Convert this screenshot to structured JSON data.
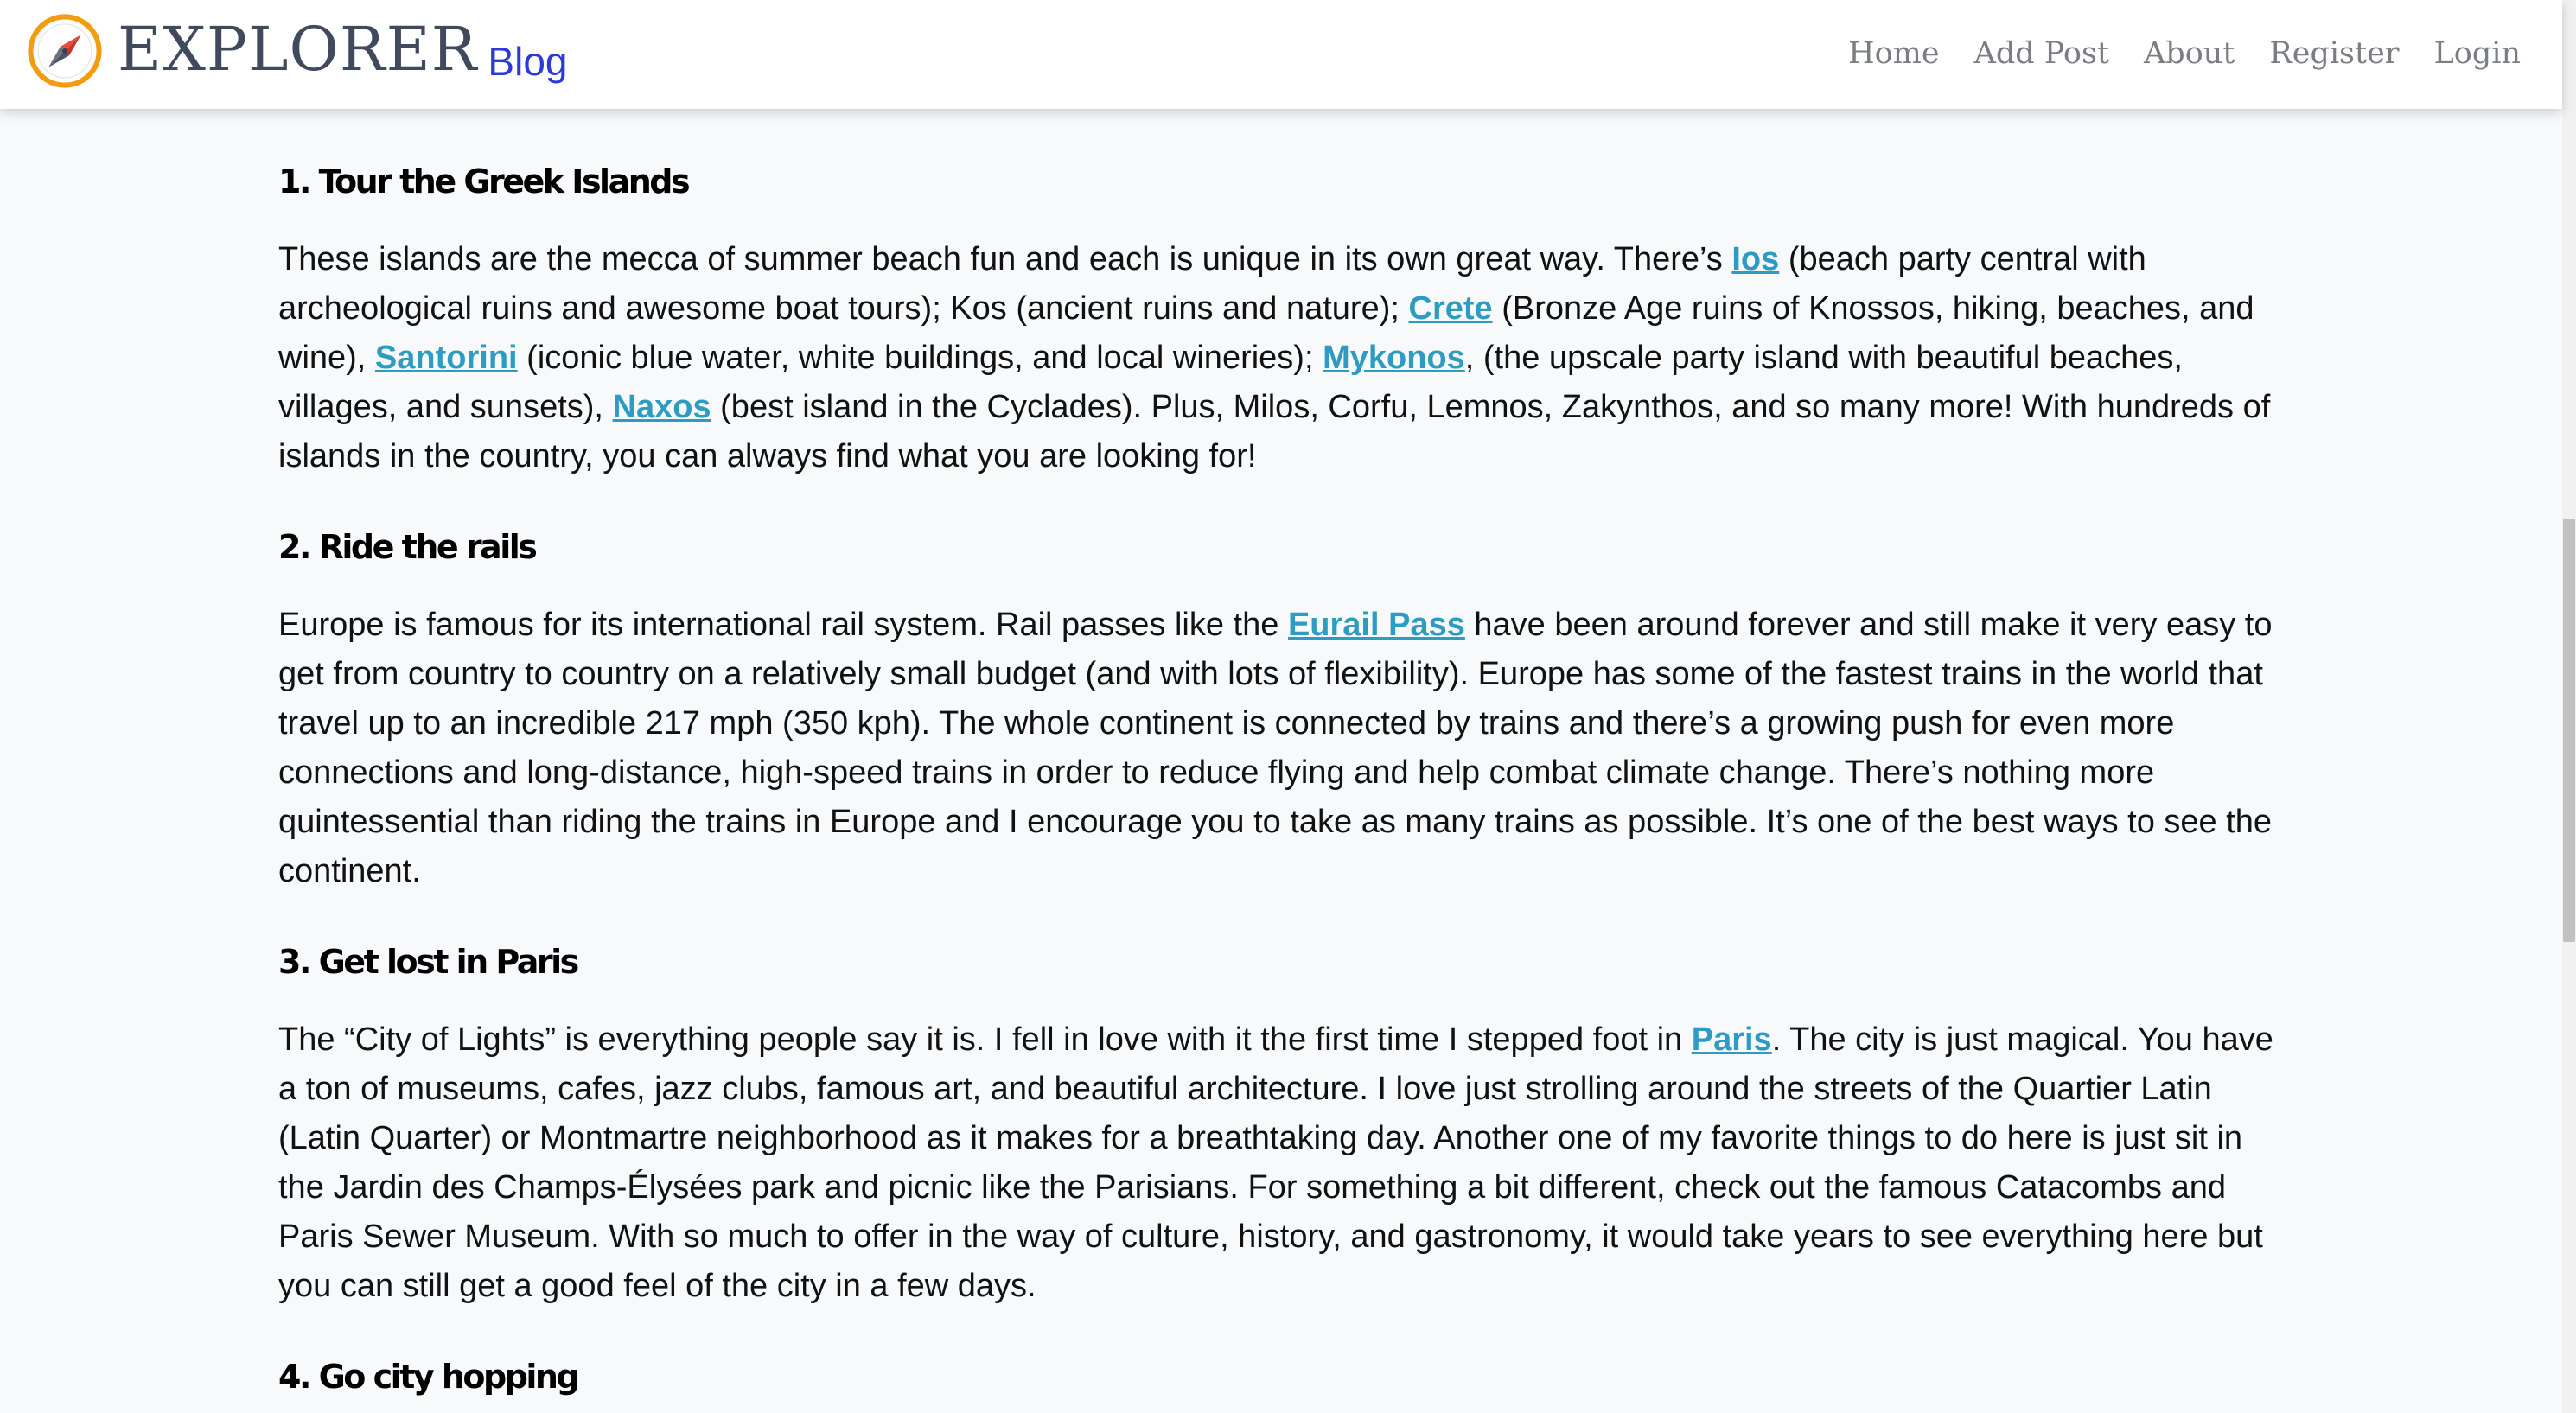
{
  "header": {
    "brand_name": "EXPLORER",
    "brand_sub": "Blog",
    "nav": [
      "Home",
      "Add Post",
      "About",
      "Register",
      "Login"
    ]
  },
  "sections": [
    {
      "heading": "1. Tour the Greek Islands",
      "text": [
        "These islands are the mecca of summer beach fun and each is unique in its own great way. There’s ",
        "Ios",
        " (beach party central with archeological ruins and awesome boat tours); Kos (ancient ruins and nature); ",
        "Crete",
        " (Bronze Age ruins of Knossos, hiking, beaches, and wine), ",
        "Santorini",
        " (iconic blue water, white buildings, and local wineries); ",
        "Mykonos",
        ", (the upscale party island with beautiful beaches, villages, and sunsets), ",
        "Naxos",
        " (best island in the Cyclades). Plus, Milos, Corfu, Lemnos, Zakynthos, and so many more! With hundreds of islands in the country, you can always find what you are looking for!"
      ]
    },
    {
      "heading": "2. Ride the rails",
      "text": [
        "Europe is famous for its international rail system. Rail passes like the ",
        "Eurail Pass",
        " have been around forever and still make it very easy to get from country to country on a relatively small budget (and with lots of flexibility). Europe has some of the fastest trains in the world that travel up to an incredible 217 mph (350 kph). The whole continent is connected by trains and there’s a growing push for even more connections and long-distance, high-speed trains in order to reduce flying and help combat climate change. There’s nothing more quintessential than riding the trains in Europe and I encourage you to take as many trains as possible. It’s one of the best ways to see the continent."
      ]
    },
    {
      "heading": "3. Get lost in Paris",
      "text": [
        "The “City of Lights” is everything people say it is. I fell in love with it the first time I stepped foot in ",
        "Paris",
        ". The city is just magical. You have a ton of museums, cafes, jazz clubs, famous art, and beautiful architecture. I love just strolling around the streets of the Quartier Latin (Latin Quarter) or Montmartre neighborhood as it makes for a breathtaking day. Another one of my favorite things to do here is just sit in the Jardin des Champs-Élysées park and picnic like the Parisians. For something a bit different, check out the famous Catacombs and Paris Sewer Museum. With so much to offer in the way of culture, history, and gastronomy, it would take years to see everything here but you can still get a good feel of the city in a few days."
      ]
    },
    {
      "heading": "4. Go city hopping"
    }
  ],
  "colors": {
    "link": "#2e9cc2",
    "brand_sub": "#2d3bd6",
    "brand_name": "#404a5c",
    "nav": "#7a7d82",
    "background": "#f8f9fa"
  }
}
